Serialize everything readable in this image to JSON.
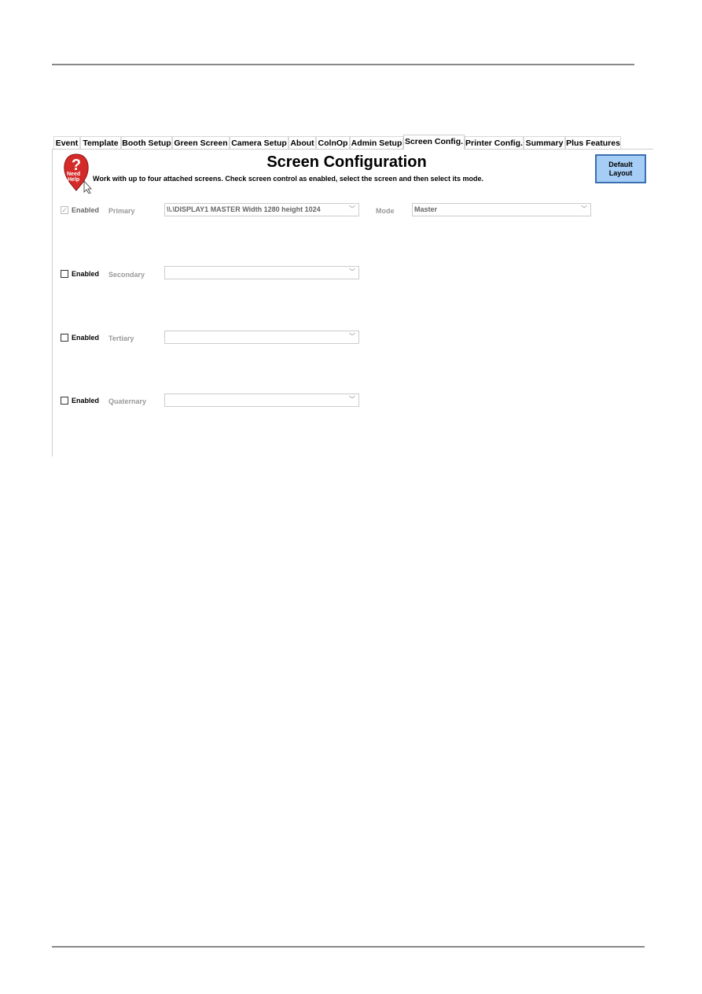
{
  "tabs": [
    {
      "label": "Event",
      "selected": false
    },
    {
      "label": "Template",
      "selected": false
    },
    {
      "label": "Booth Setup",
      "selected": false
    },
    {
      "label": "Green Screen",
      "selected": false
    },
    {
      "label": "Camera Setup",
      "selected": false
    },
    {
      "label": "About",
      "selected": false
    },
    {
      "label": "ColnOp",
      "selected": false
    },
    {
      "label": "Admin Setup",
      "selected": false
    },
    {
      "label": "Screen Config.",
      "selected": true
    },
    {
      "label": "Printer Config.",
      "selected": false
    },
    {
      "label": "Summary",
      "selected": false
    },
    {
      "label": "Plus Features",
      "selected": false
    }
  ],
  "help": {
    "line1": "Need",
    "line2": "Help",
    "icon": "question-help-icon"
  },
  "title": "Screen Configuration",
  "description": "Work with up to four attached screens. Check screen control as enabled, select the screen and  then select its mode.",
  "default_button": {
    "line1": "Default",
    "line2": "Layout"
  },
  "screens": [
    {
      "enabled_label": "Enabled",
      "checked": true,
      "disabled": true,
      "label": "Primary",
      "value": "\\\\.\\DISPLAY1  MASTER  Width 1280 height 1024",
      "mode_label": "Mode",
      "mode_value": "Master"
    },
    {
      "enabled_label": "Enabled",
      "checked": false,
      "label": "Secondary",
      "value": ""
    },
    {
      "enabled_label": "Enabled",
      "checked": false,
      "label": "Tertiary",
      "value": ""
    },
    {
      "enabled_label": "Enabled",
      "checked": false,
      "label": "Quaternary",
      "value": ""
    }
  ]
}
